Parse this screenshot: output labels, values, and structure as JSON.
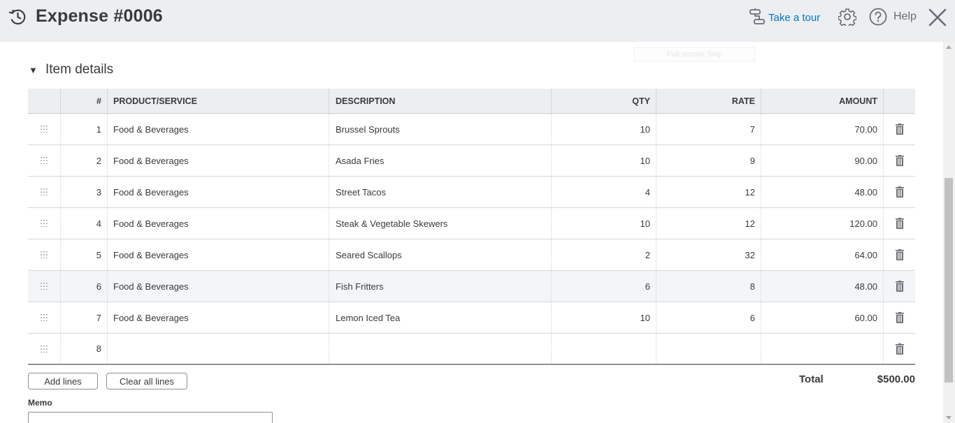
{
  "header": {
    "title": "Expense #0006",
    "tour_label": "Take a tour",
    "help_label": "Help",
    "icons": [
      "recent-transactions-icon",
      "take-tour-icon",
      "gear-icon",
      "help-icon",
      "close-icon"
    ]
  },
  "overlay": {
    "snip_label": "Full-screen Snip"
  },
  "item_details": {
    "section_label": "Item details",
    "columns": {
      "num": "#",
      "product": "PRODUCT/SERVICE",
      "description": "DESCRIPTION",
      "qty": "QTY",
      "rate": "RATE",
      "amount": "AMOUNT"
    },
    "rows": [
      {
        "num": "1",
        "product": "Food & Beverages",
        "description": "Brussel Sprouts",
        "qty": "10",
        "rate": "7",
        "amount": "70.00"
      },
      {
        "num": "2",
        "product": "Food & Beverages",
        "description": "Asada Fries",
        "qty": "10",
        "rate": "9",
        "amount": "90.00"
      },
      {
        "num": "3",
        "product": "Food & Beverages",
        "description": "Street Tacos",
        "qty": "4",
        "rate": "12",
        "amount": "48.00"
      },
      {
        "num": "4",
        "product": "Food & Beverages",
        "description": "Steak & Vegetable Skewers",
        "qty": "10",
        "rate": "12",
        "amount": "120.00"
      },
      {
        "num": "5",
        "product": "Food & Beverages",
        "description": "Seared Scallops",
        "qty": "2",
        "rate": "32",
        "amount": "64.00"
      },
      {
        "num": "6",
        "product": "Food & Beverages",
        "description": "Fish Fritters",
        "qty": "6",
        "rate": "8",
        "amount": "48.00"
      },
      {
        "num": "7",
        "product": "Food & Beverages",
        "description": "Lemon Iced Tea",
        "qty": "10",
        "rate": "6",
        "amount": "60.00"
      },
      {
        "num": "8",
        "product": "",
        "description": "",
        "qty": "",
        "rate": "",
        "amount": ""
      }
    ],
    "add_lines_label": "Add lines",
    "clear_lines_label": "Clear all lines",
    "total_label": "Total",
    "total_value": "$500.00"
  },
  "memo": {
    "label": "Memo",
    "value": ""
  },
  "colors": {
    "header_bg": "#eceef1",
    "link": "#0077c5",
    "text": "#393a3d",
    "highlight_row": "#f4f5f8"
  }
}
